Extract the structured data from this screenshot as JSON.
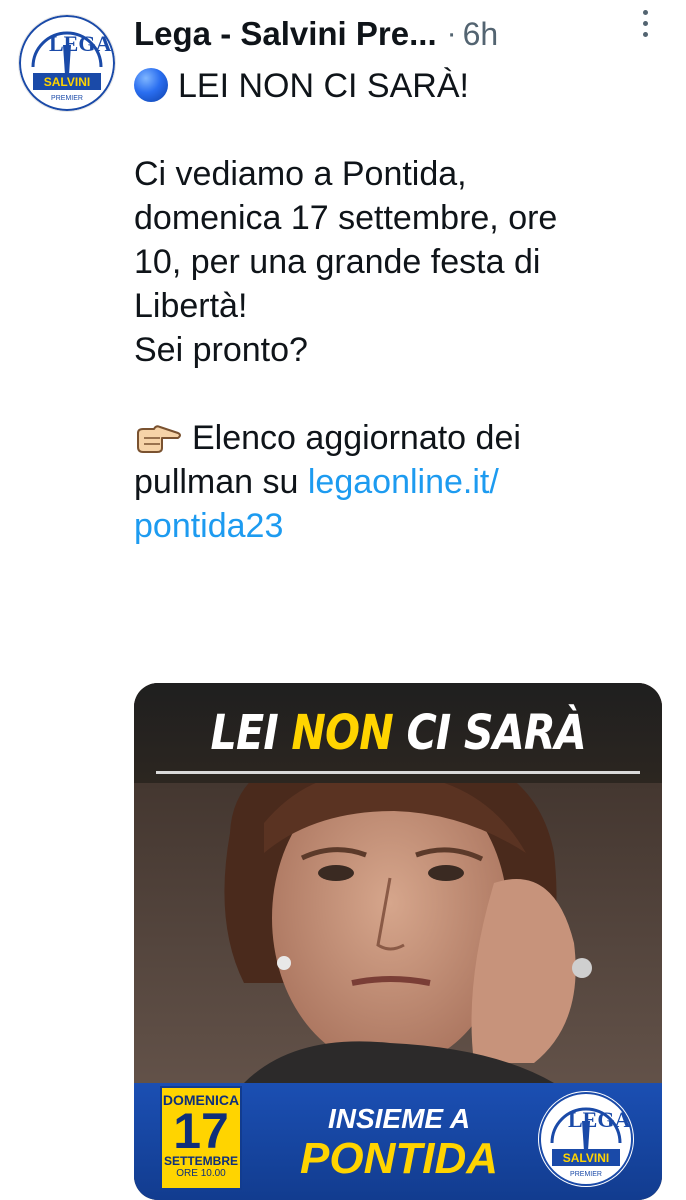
{
  "post": {
    "author": "Lega - Salvini Pre...",
    "separator": "·",
    "time": "6h",
    "avatar_logo": {
      "top_text": "LEGA",
      "middle_text": "SALVINI",
      "bottom_text": "PREMIER"
    }
  },
  "tweet": {
    "line1": "LEI NON CI SARÀ!",
    "paragraph2": [
      "Ci vediamo a Pontida,",
      "domenica 17 settembre, ore",
      "10, per una grande festa di",
      "Libertà!",
      "Sei pronto?"
    ],
    "paragraph3_lines": [
      "Elenco aggiornato dei",
      "pullman su "
    ],
    "link_part1": "legaonline.it/",
    "link_part2": "pontida23"
  },
  "media": {
    "headline_part1": "LEI ",
    "headline_part2": "NON",
    "headline_part3": " CI SARÀ",
    "date_day_name": "DOMENICA",
    "date_day": "17",
    "date_month": "SETTEMBRE",
    "date_time": "ORE 10.00",
    "insieme": "INSIEME A",
    "pontida": "PONTIDA",
    "logo_top": "LEGA",
    "logo_middle": "SALVINI",
    "logo_bottom": "PREMIER"
  },
  "icons": {
    "emoji": "blue-circle-emoji",
    "pointer": "backhand-index-pointing-right-emoji",
    "more": "more-vertical-icon"
  },
  "colors": {
    "link": "#1d9bf0",
    "text": "#0f1419",
    "muted": "#536471",
    "lega_blue": "#123c8f",
    "yellow": "#ffd400"
  }
}
